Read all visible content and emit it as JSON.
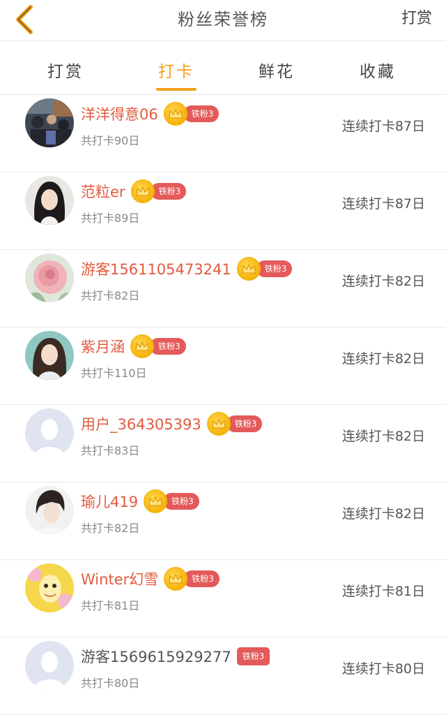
{
  "header": {
    "title": "粉丝荣誉榜",
    "action_label": "打赏"
  },
  "tabs": [
    {
      "label": "打赏",
      "active": false
    },
    {
      "label": "打卡",
      "active": true
    },
    {
      "label": "鲜花",
      "active": false
    },
    {
      "label": "收藏",
      "active": false
    }
  ],
  "colors": {
    "accent": "#f3a01b",
    "name": "#e25a3e",
    "badge": "#e45a5a"
  },
  "rows": [
    {
      "name": "洋洋得意06",
      "badge": "铁粉3",
      "crown": true,
      "total": "共打卡90日",
      "streak": "连续打卡87日",
      "avatar": "photo-crowd"
    },
    {
      "name": "范粒er",
      "badge": "铁粉3",
      "crown": true,
      "total": "共打卡89日",
      "streak": "连续打卡87日",
      "avatar": "photo-girl-dark-hair"
    },
    {
      "name": "游客1561105473241",
      "badge": "铁粉3",
      "crown": true,
      "total": "共打卡82日",
      "streak": "连续打卡82日",
      "avatar": "photo-rose"
    },
    {
      "name": "紫月涵",
      "badge": "铁粉3",
      "crown": true,
      "total": "共打卡110日",
      "streak": "连续打卡82日",
      "avatar": "photo-woman-smiling"
    },
    {
      "name": "用户_364305393",
      "badge": "铁粉3",
      "crown": true,
      "total": "共打卡83日",
      "streak": "连续打卡82日",
      "avatar": "default-user"
    },
    {
      "name": "瑜儿419",
      "badge": "铁粉3",
      "crown": true,
      "total": "共打卡82日",
      "streak": "连续打卡82日",
      "avatar": "photo-boy"
    },
    {
      "name": "Winter幻雪",
      "badge": "铁粉3",
      "crown": true,
      "total": "共打卡81日",
      "streak": "连续打卡81日",
      "avatar": "photo-cartoon-yellow"
    },
    {
      "name": "游客1569615929277",
      "badge": "铁粉3",
      "crown": false,
      "total": "共打卡80日",
      "streak": "连续打卡80日",
      "avatar": "default-user"
    }
  ]
}
